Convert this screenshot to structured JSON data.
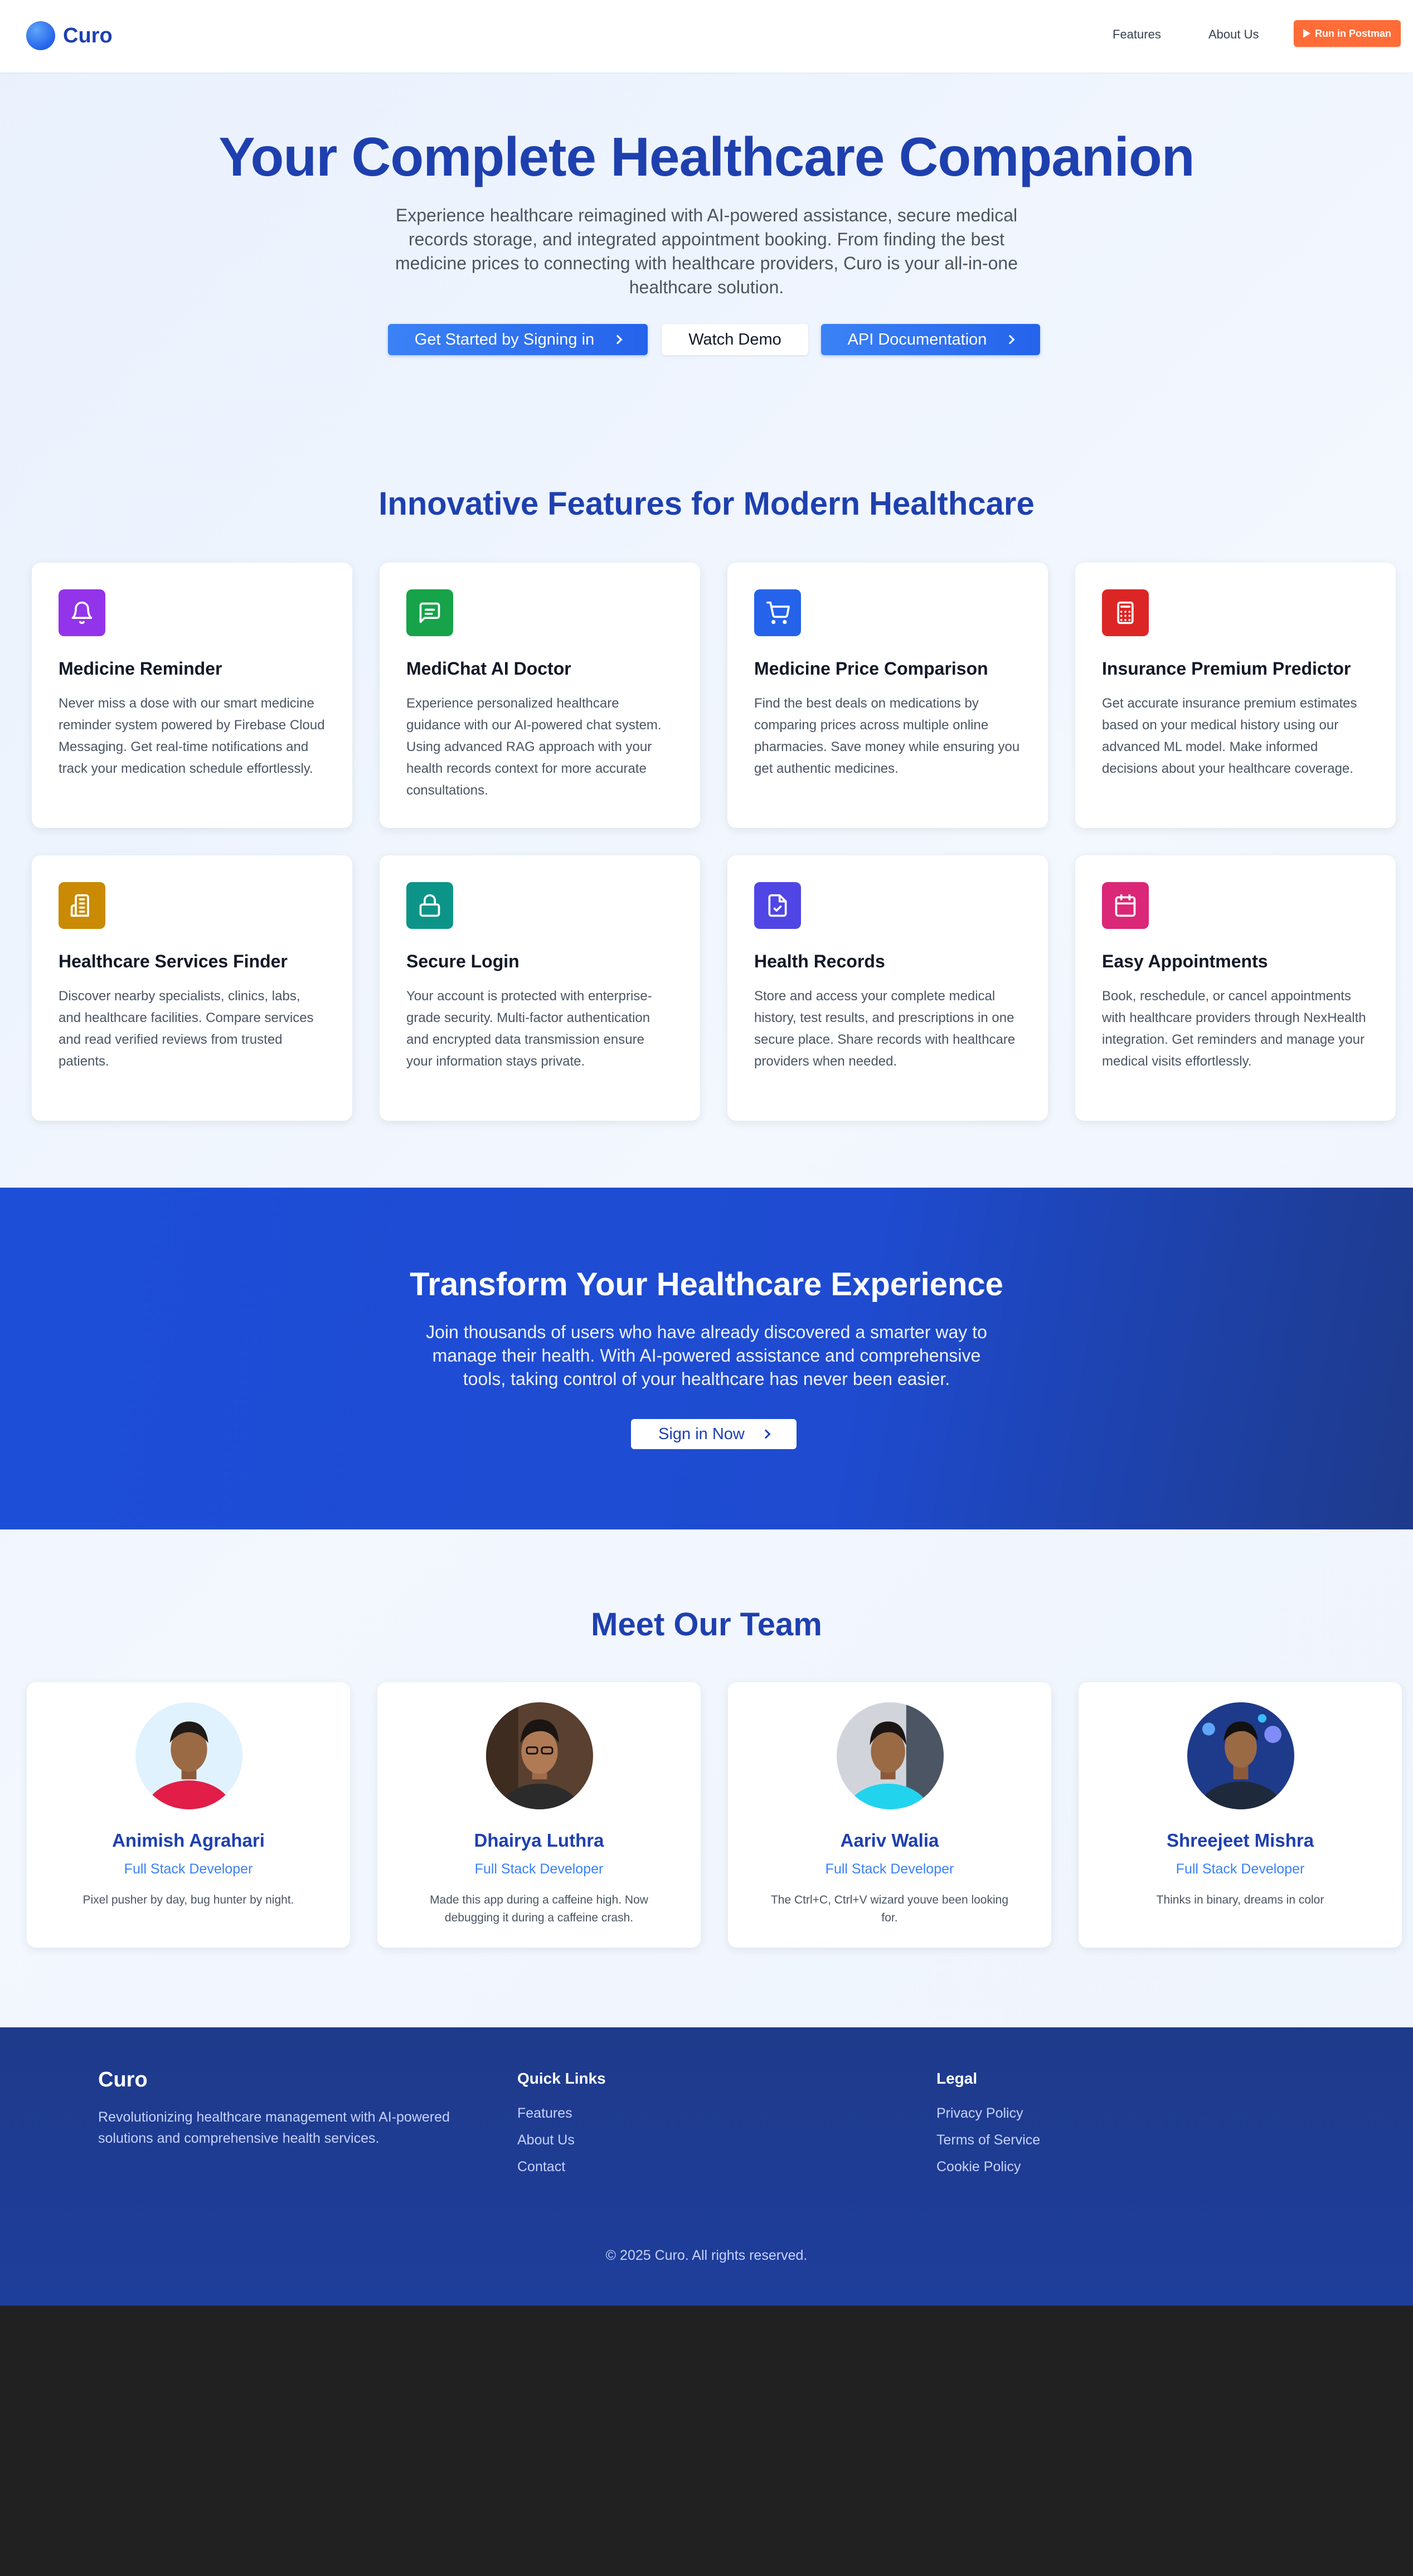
{
  "nav": {
    "logo": "Curo",
    "links": [
      "Features",
      "About Us"
    ],
    "postman_button": "Run in Postman"
  },
  "hero": {
    "title": "Your Complete Healthcare Companion",
    "subtitle": "Experience healthcare reimagined with AI-powered assistance, secure medical records storage, and integrated appointment booking. From finding the best medicine prices to connecting with healthcare providers, Curo is your all-in-one healthcare solution.",
    "buttons": {
      "get_started": "Get Started by Signing in",
      "watch_demo": "Watch Demo",
      "api_docs": "API Documentation"
    }
  },
  "features": {
    "title": "Innovative Features for Modern Healthcare",
    "items": [
      {
        "title": "Medicine Reminder",
        "desc": "Never miss a dose with our smart medicine reminder system powered by Firebase Cloud Messaging. Get real-time notifications and track your medication schedule effortlessly.",
        "icon": "bell-icon",
        "color": "#9333ea"
      },
      {
        "title": "MediChat AI Doctor",
        "desc": "Experience personalized healthcare guidance with our AI-powered chat system. Using advanced RAG approach with your health records context for more accurate consultations.",
        "icon": "chat-icon",
        "color": "#16a34a"
      },
      {
        "title": "Medicine Price Comparison",
        "desc": "Find the best deals on medications by comparing prices across multiple online pharmacies. Save money while ensuring you get authentic medicines.",
        "icon": "cart-icon",
        "color": "#2563eb"
      },
      {
        "title": "Insurance Premium Predictor",
        "desc": "Get accurate insurance premium estimates based on your medical history using our advanced ML model. Make informed decisions about your healthcare coverage.",
        "icon": "calculator-icon",
        "color": "#dc2626"
      },
      {
        "title": "Healthcare Services Finder",
        "desc": "Discover nearby specialists, clinics, labs, and healthcare facilities. Compare services and read verified reviews from trusted patients.",
        "icon": "building-icon",
        "color": "#ca8a04"
      },
      {
        "title": "Secure Login",
        "desc": "Your account is protected with enterprise-grade security. Multi-factor authentication and encrypted data transmission ensure your information stays private.",
        "icon": "lock-icon",
        "color": "#0d9488"
      },
      {
        "title": "Health Records",
        "desc": "Store and access your complete medical history, test results, and prescriptions in one secure place. Share records with healthcare providers when needed.",
        "icon": "file-check-icon",
        "color": "#4f46e5"
      },
      {
        "title": "Easy Appointments",
        "desc": "Book, reschedule, or cancel appointments with healthcare providers through NexHealth integration. Get reminders and manage your medical visits effortlessly.",
        "icon": "calendar-icon",
        "color": "#db2777"
      }
    ]
  },
  "cta": {
    "title": "Transform Your Healthcare Experience",
    "subtitle": "Join thousands of users who have already discovered a smarter way to manage their health. With AI-powered assistance and comprehensive tools, taking control of your healthcare has never been easier.",
    "button": "Sign in Now"
  },
  "team": {
    "title": "Meet Our Team",
    "members": [
      {
        "name": "Animish Agrahari",
        "role": "Full Stack Developer",
        "bio": "Pixel pusher by day, bug hunter by night."
      },
      {
        "name": "Dhairya Luthra",
        "role": "Full Stack Developer",
        "bio": "Made this app during a caffeine high. Now debugging it during a caffeine crash."
      },
      {
        "name": "Aariv Walia",
        "role": "Full Stack Developer",
        "bio": "The Ctrl+C, Ctrl+V wizard youve been looking for."
      },
      {
        "name": "Shreejeet Mishra",
        "role": "Full Stack Developer",
        "bio": "Thinks in binary, dreams in color"
      }
    ]
  },
  "footer": {
    "brand": "Curo",
    "desc": "Revolutionizing healthcare management with AI-powered solutions and comprehensive health services.",
    "quick_links_title": "Quick Links",
    "quick_links": [
      "Features",
      "About Us",
      "Contact"
    ],
    "legal_title": "Legal",
    "legal_links": [
      "Privacy Policy",
      "Terms of Service",
      "Cookie Policy"
    ],
    "copyright": "© 2025 Curo. All rights reserved."
  }
}
